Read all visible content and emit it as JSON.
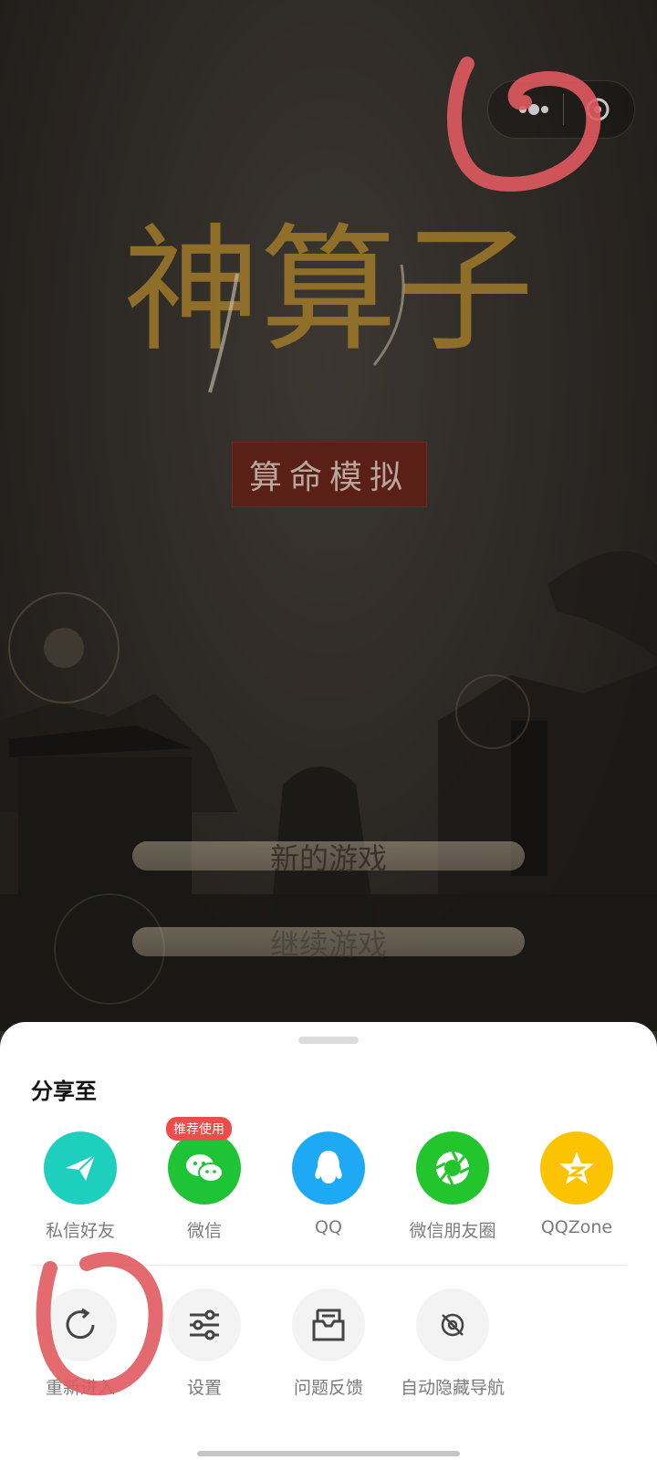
{
  "game": {
    "title": "神算子",
    "subtitle": "算命模拟",
    "menu": {
      "new_game": "新的游戏",
      "continue_game": "继续游戏"
    }
  },
  "capsule": {
    "more_icon": "more-dots-icon",
    "close_icon": "close-circle-icon"
  },
  "share_sheet": {
    "title": "分享至",
    "share_targets": [
      {
        "label": "私信好友",
        "icon": "paper-plane-icon",
        "color": "#1ecfbe"
      },
      {
        "label": "微信",
        "icon": "wechat-icon",
        "color": "#1fc336",
        "tag": "推荐使用"
      },
      {
        "label": "QQ",
        "icon": "qq-penguin-icon",
        "color": "#1ea9f5"
      },
      {
        "label": "微信朋友圈",
        "icon": "moments-shutter-icon",
        "color": "#22c52c"
      },
      {
        "label": "QQZone",
        "icon": "qzone-star-icon",
        "color": "#fbc300"
      }
    ],
    "actions": [
      {
        "label": "重新进入",
        "icon": "refresh-icon"
      },
      {
        "label": "设置",
        "icon": "sliders-icon"
      },
      {
        "label": "问题反馈",
        "icon": "feedback-icon"
      },
      {
        "label": "自动隐藏导航",
        "icon": "hide-nav-icon"
      }
    ]
  },
  "annotation_color": "#e05a5f"
}
